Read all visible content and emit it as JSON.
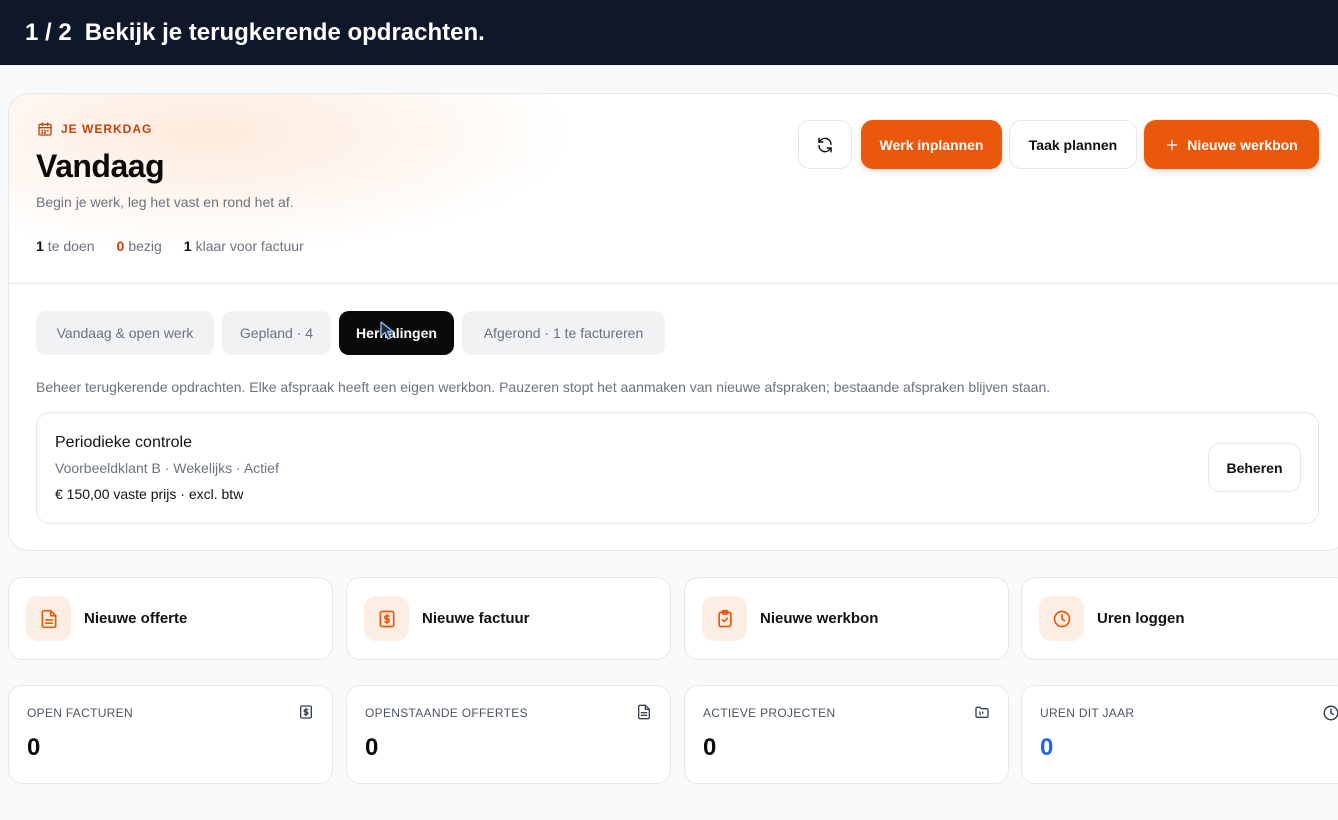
{
  "banner": {
    "step": "1 / 2",
    "text": "Bekijk je terugkerende opdrachten."
  },
  "workday": {
    "eyebrow": "JE WERKDAG",
    "title": "Vandaag",
    "subtitle": "Begin je werk, leg het vast en rond het af.",
    "stats": [
      {
        "count": "1",
        "label": "te doen"
      },
      {
        "count": "0",
        "label": "bezig"
      },
      {
        "count": "1",
        "label": "klaar voor factuur"
      }
    ]
  },
  "actions": {
    "werk_inplannen": "Werk inplannen",
    "taak_plannen": "Taak plannen",
    "nieuwe_werkbon": "Nieuwe werkbon"
  },
  "tabs": [
    {
      "label": "Vandaag & open werk"
    },
    {
      "label": "Gepland · 4"
    },
    {
      "label": "Herhalingen"
    },
    {
      "label": "Afgerond · 1 te factureren"
    }
  ],
  "active_tab": "Herhalingen",
  "recurring": {
    "description": "Beheer terugkerende opdrachten. Elke afspraak heeft een eigen werkbon. Pauzeren stopt het aanmaken van nieuwe afspraken; bestaande afspraken blijven staan.",
    "items": [
      {
        "title": "Periodieke controle",
        "meta": "Voorbeeldklant B · Wekelijks · Actief",
        "price": "€ 150,00 vaste prijs · excl. btw",
        "manage_label": "Beheren"
      }
    ]
  },
  "quick_actions": [
    {
      "label": "Nieuwe offerte",
      "icon": "document-icon"
    },
    {
      "label": "Nieuwe factuur",
      "icon": "invoice-icon"
    },
    {
      "label": "Nieuwe werkbon",
      "icon": "clipboard-check-icon"
    },
    {
      "label": "Uren loggen",
      "icon": "clock-icon"
    }
  ],
  "metrics": [
    {
      "label": "OPEN FACTUREN",
      "value": "0",
      "icon": "invoice-icon"
    },
    {
      "label": "OPENSTAANDE OFFERTES",
      "value": "0",
      "icon": "document-icon"
    },
    {
      "label": "ACTIEVE PROJECTEN",
      "value": "0",
      "icon": "folder-icon"
    },
    {
      "label": "UREN DIT JAAR",
      "value": "0",
      "icon": "clock-icon"
    }
  ],
  "colors": {
    "banner_bg": "#0f172a",
    "accent": "#ea580c",
    "accent_text": "#c2410c",
    "active_tab_bg": "#0a0a0a",
    "hours_value": "#2563eb"
  }
}
